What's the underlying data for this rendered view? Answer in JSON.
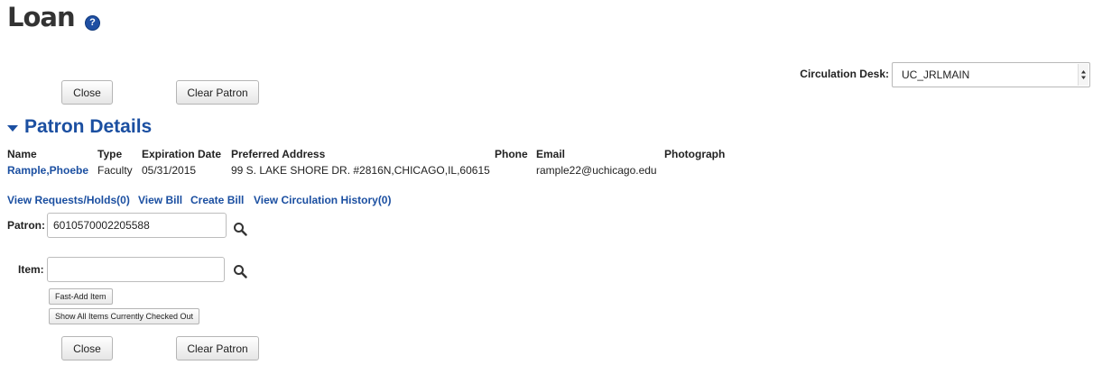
{
  "page": {
    "title": "Loan",
    "help_icon": "?"
  },
  "toolbar": {
    "close_label": "Close",
    "clear_patron_label": "Clear Patron"
  },
  "circulation_desk": {
    "label": "Circulation Desk:",
    "selected": "UC_JRLMAIN"
  },
  "patron_details": {
    "section_title": "Patron Details",
    "columns": [
      "Name",
      "Type",
      "Expiration Date",
      "Preferred Address",
      "Phone",
      "Email",
      "Photograph"
    ],
    "row": {
      "name": "Rample,Phoebe",
      "type": "Faculty",
      "expiration_date": "05/31/2015",
      "preferred_address": "99 S. LAKE SHORE DR. #2816N,CHICAGO,IL,60615",
      "phone": "",
      "email": "rample22@uchicago.edu",
      "photograph": ""
    }
  },
  "links": {
    "view_requests": "View Requests/Holds(0)",
    "view_bill": "View Bill",
    "create_bill": "Create Bill",
    "view_history": "View Circulation History(0)"
  },
  "patron_field": {
    "label": "Patron:",
    "value": "6010570002205588"
  },
  "item_field": {
    "label": "Item:",
    "value": ""
  },
  "item_buttons": {
    "fast_add": "Fast-Add Item",
    "show_all": "Show All Items Currently Checked Out"
  },
  "colors": {
    "accent": "#1b4fa1",
    "help_icon_bg": "#1f4fa3"
  },
  "icons": {
    "help": "help-icon",
    "search": "search-icon",
    "collapse": "triangle-down-icon",
    "dropdown": "dropdown-arrow-icon"
  }
}
